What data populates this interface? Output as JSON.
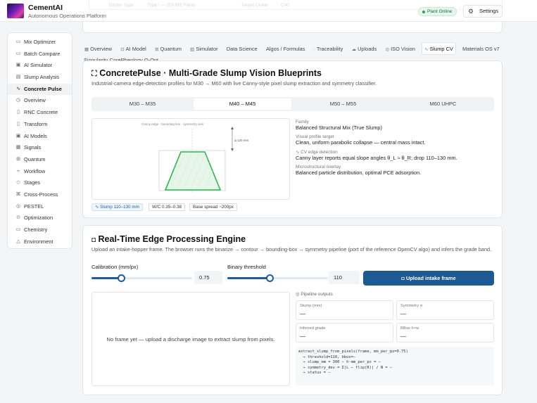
{
  "app": {
    "title": "CementAI",
    "subtitle": "Autonomous Operations Platform",
    "status": "Plant Online",
    "settings_label": "Settings",
    "ghost_fields": [
      "Binder Type",
      "Type I — (Ex-Mill Plant)",
      "Target Grade",
      "C40"
    ]
  },
  "sidebar": {
    "items": [
      {
        "label": "Mix Optimizer",
        "icon": "flask-icon"
      },
      {
        "label": "Batch Compare",
        "icon": "compare-icon"
      },
      {
        "label": "AI Simulator",
        "icon": "simulator-icon"
      },
      {
        "label": "Slump Analysis",
        "icon": "analysis-icon"
      },
      {
        "label": "Concrete Pulse",
        "icon": "pulse-icon",
        "active": true
      },
      {
        "label": "Overview",
        "icon": "overview-icon"
      },
      {
        "label": "RNC Concrete",
        "icon": "document-icon"
      },
      {
        "label": "Transform",
        "icon": "transform-icon"
      },
      {
        "label": "AI Models",
        "icon": "model-icon"
      },
      {
        "label": "Signals",
        "icon": "signal-icon"
      },
      {
        "label": "Quantum",
        "icon": "quantum-icon"
      },
      {
        "label": "Workflow",
        "icon": "workflow-icon"
      },
      {
        "label": "Stages",
        "icon": "layers-icon"
      },
      {
        "label": "Cross-Process",
        "icon": "cross-icon"
      },
      {
        "label": "PESTEL",
        "icon": "globe-icon"
      },
      {
        "label": "Optimization",
        "icon": "target-icon"
      },
      {
        "label": "Chemistry",
        "icon": "chemistry-icon"
      },
      {
        "label": "Environment",
        "icon": "leaf-icon"
      }
    ]
  },
  "tabs": [
    {
      "label": "Overview",
      "icon": "grid-icon"
    },
    {
      "label": "AI Model",
      "icon": "ai-icon"
    },
    {
      "label": "Quantum",
      "icon": "quantum-icon"
    },
    {
      "label": "Simulator",
      "icon": "simulator-icon"
    },
    {
      "label": "Data Science",
      "icon": ""
    },
    {
      "label": "Algos / Formulas",
      "icon": ""
    },
    {
      "label": "Traceability",
      "icon": "dot-icon"
    },
    {
      "label": "Uploads",
      "icon": "upload-icon"
    },
    {
      "label": "ISO Vision",
      "icon": "iso-icon"
    },
    {
      "label": "Slump CV",
      "icon": "scan-icon",
      "active": true
    },
    {
      "label": "Materials OS v7",
      "icon": ""
    }
  ],
  "tabs_second_row": "Singularity CoreRheology Q-Opt",
  "blueprints": {
    "title": "ConcretePulse · Multi-Grade Slump Vision Blueprints",
    "subtitle": "Industrial-camera edge-detection profiles for M30 → M60 with live Canny-style pixel slump extraction and symmetry classifier.",
    "grades": [
      "M30 – M35",
      "M40 – M45",
      "M50 – M55",
      "M60 UHPC"
    ],
    "active_grade": "M40 – M45",
    "canvas_caption": "Canny edge · bounding box · symmetry axis",
    "dimension_label": "Δ 120 mm",
    "family_label": "Family",
    "family_value": "Balanced Structural Mix (True Slump)",
    "visual_label": "Visual profile target",
    "visual_value": "Clean, uniform parabolic collapse — central mass intact.",
    "cv_label": "CV edge detection",
    "cv_value": "Canny layer reports equal slope angles θ_L ≈ θ_R; drop 110–130 mm.",
    "micro_label": "Microstructural overlay",
    "micro_value": "Balanced particle distribution, optimal PCE adsorption.",
    "chips": [
      "Slump 110–130 mm",
      "W/C 0.35–0.38",
      "Base spread ~200px"
    ],
    "accent": "#2db84d"
  },
  "engine": {
    "title": "Real-Time Edge Processing Engine",
    "subtitle": "Upload an intake-hopper frame. The browser runs the binarize → contour → bounding-box → symmetry pipeline (port of the reference OpenCV algo) and infers the grade band.",
    "calibration_label": "Calibration (mm/px)",
    "calibration_value": "0.75",
    "calibration_fraction": 0.3,
    "threshold_label": "Binary threshold",
    "threshold_value": "110",
    "threshold_fraction": 0.42,
    "upload_label": "Upload intake frame",
    "empty_message": "No frame yet — upload a discharge image to extract slump from pixels.",
    "pipeline_label": "Pipeline outputs",
    "metrics": [
      {
        "label": "Slump (mm)",
        "value": "—"
      },
      {
        "label": "Symmetry σ",
        "value": "—"
      },
      {
        "label": "Inferred grade",
        "value": "—"
      },
      {
        "label": "BBox h×w",
        "value": "—"
      }
    ],
    "code": "extract_slump_from_pixels(frame, mm_per_px=0.75)\n  → threshold=110, bbox=—\n  → slump_mm = 300 − h·mm_per_px = —\n  → symmetry_dev = Σ|L − flip(R)| / N = —\n  → status = —"
  }
}
